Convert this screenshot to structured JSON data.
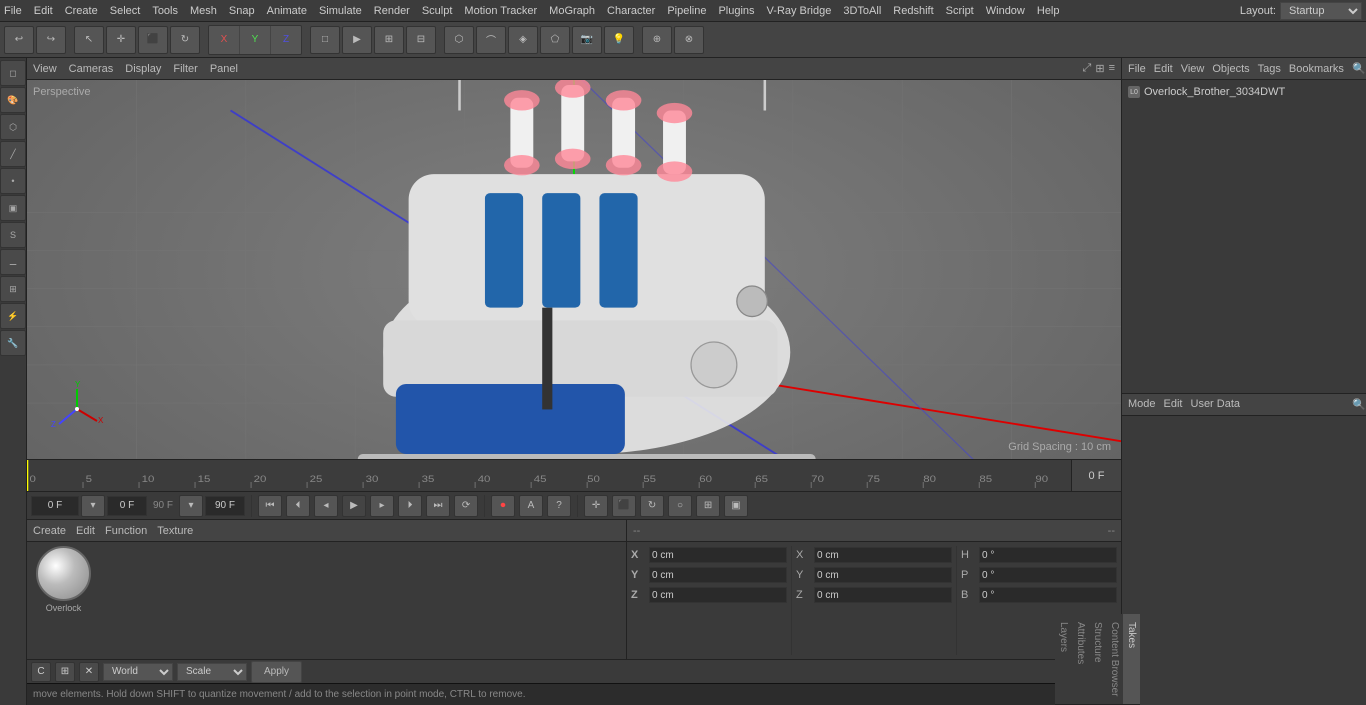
{
  "menubar": {
    "items": [
      "File",
      "Edit",
      "Create",
      "Select",
      "Tools",
      "Mesh",
      "Snap",
      "Animate",
      "Simulate",
      "Render",
      "Sculpt",
      "Motion Tracker",
      "MoGraph",
      "Character",
      "Pipeline",
      "Plugins",
      "V-Ray Bridge",
      "3DToAll",
      "Redshift",
      "Script",
      "Window",
      "Help"
    ],
    "layout_label": "Layout:",
    "layout_value": "Startup"
  },
  "toolbar2": {
    "undo_icon": "↩",
    "redo_icon": "↪",
    "select_icon": "↖",
    "move_icon": "✛",
    "scale_icon": "⬛",
    "rotate_icon": "↻",
    "x_icon": "X",
    "y_icon": "Y",
    "z_icon": "Z",
    "box_icon": "□",
    "camera_icon": "📷"
  },
  "viewport": {
    "header_items": [
      "View",
      "Cameras",
      "Display",
      "Filter",
      "Panel"
    ],
    "perspective_label": "Perspective",
    "grid_spacing": "Grid Spacing : 10 cm"
  },
  "timeline": {
    "marks": [
      "0",
      "5",
      "10",
      "15",
      "20",
      "25",
      "30",
      "35",
      "40",
      "45",
      "50",
      "55",
      "60",
      "65",
      "70",
      "75",
      "80",
      "85",
      "90"
    ],
    "frame_display": "0 F",
    "start_frame": "0 F",
    "end_frame_1": "90 F",
    "end_frame_2": "90 F"
  },
  "playback": {
    "start_btn": "⏮",
    "prev_btn": "⏴",
    "play_btn": "▶",
    "next_btn": "⏵",
    "end_btn": "⏭",
    "loop_btn": "⟳",
    "record_btn": "⏺",
    "auto_btn": "A",
    "help_btn": "?"
  },
  "objects_panel": {
    "header_items": [
      "File",
      "Edit",
      "View",
      "Objects",
      "Tags",
      "Bookmarks"
    ],
    "object_name": "Overlock_Brother_3034DWT",
    "object_icon": "L0"
  },
  "attributes_panel": {
    "header_items": [
      "Mode",
      "Edit",
      "User Data"
    ],
    "coord_labels": {
      "x": "X",
      "y": "Y",
      "z": "Z",
      "h": "H",
      "p": "P",
      "b": "B"
    },
    "values": {
      "x1": "0 cm",
      "y1": "0 cm",
      "z1": "0 cm",
      "x2": "0 cm",
      "y2": "0 cm",
      "z2": "0 cm",
      "h": "0 °",
      "p": "0 °",
      "b": "0 °"
    }
  },
  "materials": {
    "header_items": [
      "Create",
      "Edit",
      "Function",
      "Texture"
    ],
    "item_label": "Overlock"
  },
  "bottom_bar": {
    "world_label": "World",
    "scale_label": "Scale",
    "apply_label": "Apply"
  },
  "status_bar": {
    "message": "move elements. Hold down SHIFT to quantize movement / add to the selection in point mode, CTRL to remove."
  },
  "right_tabs": {
    "tabs": [
      "Takes",
      "Content Browser",
      "Structure",
      "Attributes",
      "Layers"
    ]
  }
}
